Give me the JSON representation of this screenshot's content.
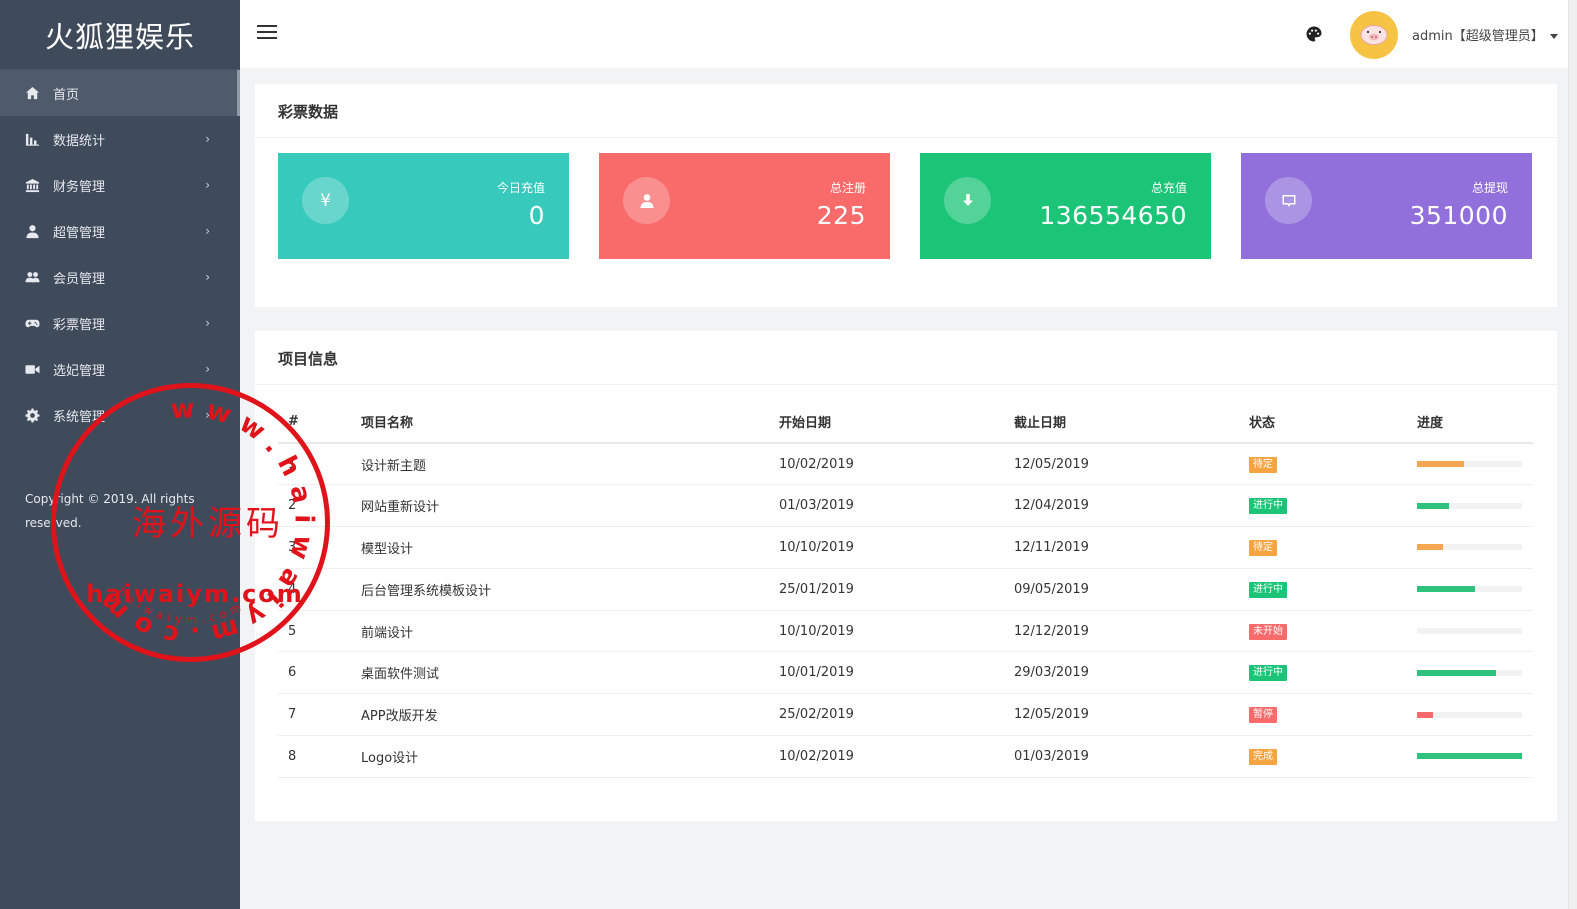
{
  "brand": "火狐狸娱乐",
  "sidebar": {
    "items": [
      {
        "label": "首页",
        "icon": "home-icon",
        "active": true
      },
      {
        "label": "数据统计",
        "icon": "bar-chart-icon"
      },
      {
        "label": "财务管理",
        "icon": "bank-icon"
      },
      {
        "label": "超管管理",
        "icon": "user-icon"
      },
      {
        "label": "会员管理",
        "icon": "users-icon"
      },
      {
        "label": "彩票管理",
        "icon": "gamepad-icon"
      },
      {
        "label": "选妃管理",
        "icon": "video-icon"
      },
      {
        "label": "系统管理",
        "icon": "gear-icon"
      }
    ],
    "copyright": "Copyright © 2019. All rights reserved."
  },
  "header": {
    "user": "admin【超级管理员】"
  },
  "lottery": {
    "title": "彩票数据",
    "cards": [
      {
        "label": "今日充值",
        "value": "0",
        "icon": "yen-icon",
        "color": "#37c9bc"
      },
      {
        "label": "总注册",
        "value": "225",
        "icon": "user-icon",
        "color": "#f96a6b"
      },
      {
        "label": "总充值",
        "value": "136554650",
        "icon": "download-icon",
        "color": "#1bc477"
      },
      {
        "label": "总提现",
        "value": "351000",
        "icon": "message-icon",
        "color": "#9170db"
      }
    ]
  },
  "projects": {
    "title": "项目信息",
    "columns": [
      "#",
      "项目名称",
      "开始日期",
      "截止日期",
      "状态",
      "进度"
    ],
    "rows": [
      {
        "id": "1",
        "name": "设计新主题",
        "start": "10/02/2019",
        "end": "12/05/2019",
        "status": "待定",
        "status_color": "#f5a442",
        "progress": 0.45,
        "progress_color": "#f4a651"
      },
      {
        "id": "2",
        "name": "网站重新设计",
        "start": "01/03/2019",
        "end": "12/04/2019",
        "status": "进行中",
        "status_color": "#1bc477",
        "progress": 0.3,
        "progress_color": "#2ec27e"
      },
      {
        "id": "3",
        "name": "模型设计",
        "start": "10/10/2019",
        "end": "12/11/2019",
        "status": "待定",
        "status_color": "#f5a442",
        "progress": 0.25,
        "progress_color": "#f4a651"
      },
      {
        "id": "4",
        "name": "后台管理系统模板设计",
        "start": "25/01/2019",
        "end": "09/05/2019",
        "status": "进行中",
        "status_color": "#1bc477",
        "progress": 0.55,
        "progress_color": "#2ec27e"
      },
      {
        "id": "5",
        "name": "前端设计",
        "start": "10/10/2019",
        "end": "12/12/2019",
        "status": "未开始",
        "status_color": "#f96a6b",
        "progress": 0,
        "progress_color": "#f96a6b"
      },
      {
        "id": "6",
        "name": "桌面软件测试",
        "start": "10/01/2019",
        "end": "29/03/2019",
        "status": "进行中",
        "status_color": "#1bc477",
        "progress": 0.75,
        "progress_color": "#2ec27e"
      },
      {
        "id": "7",
        "name": "APP改版开发",
        "start": "25/02/2019",
        "end": "12/05/2019",
        "status": "暂停",
        "status_color": "#f96a6b",
        "progress": 0.15,
        "progress_color": "#f96a6b"
      },
      {
        "id": "8",
        "name": "Logo设计",
        "start": "10/02/2019",
        "end": "01/03/2019",
        "status": "完成",
        "status_color": "#f5a442",
        "progress": 1.0,
        "progress_color": "#2ec27e"
      }
    ]
  },
  "watermark": {
    "ring_text": "www.haiwaiym.com",
    "center_text": "海外源码",
    "url_text": "haiwaiym.com",
    "small_text": "haiwaiym.com"
  }
}
